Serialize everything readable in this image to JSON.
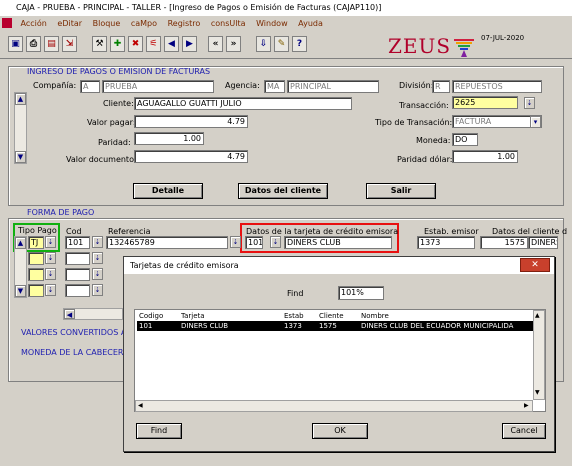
{
  "window": {
    "title": "CAJA - PRUEBA - PRINCIPAL - TALLER - [Ingreso de Pagos o Emisión de Facturas (CAJAP110)]"
  },
  "menu": [
    "Acción",
    "eDitar",
    "Bloque",
    "caMpo",
    "Registro",
    "consUlta",
    "Window",
    "Ayuda"
  ],
  "brand": {
    "name": "ZEUS",
    "date": "07-JUL-2020"
  },
  "header": {
    "section_title": "INGRESO DE PAGOS O EMISION DE FACTURAS",
    "compania_label": "Compañía:",
    "compania_code": "A",
    "compania_name": "PRUEBA",
    "agencia_label": "Agencia:",
    "agencia_code": "MA",
    "agencia_name": "PRINCIPAL",
    "division_label": "División:",
    "division_code": "R",
    "division_name": "REPUESTOS",
    "cliente_label": "Cliente:",
    "cliente_value": "AGUAGALLO GUATTI JULIO",
    "transaccion_label": "Transacción:",
    "transaccion_value": "2625",
    "valor_pagar_label": "Valor pagar:",
    "valor_pagar_value": "4.79",
    "tipo_transaccion_label": "Tipo de Transación:",
    "tipo_transaccion_value": "FACTURA",
    "paridad_label": "Paridad:",
    "paridad_value": "1.00",
    "moneda_label": "Moneda:",
    "moneda_value": "DO",
    "valor_documento_label": "Valor documento:",
    "valor_documento_value": "4.79",
    "paridad_dolar_label": "Paridad dólar:",
    "paridad_dolar_value": "1.00"
  },
  "actions": {
    "detalle": "Detalle",
    "datos_cliente": "Datos del cliente",
    "salir": "Salir"
  },
  "payment": {
    "section_title": "FORMA DE PAGO",
    "col_tipo_pago": "Tipo Pago",
    "col_cod": "Cod",
    "col_referencia": "Referencia",
    "col_datos_tarjeta": "Datos de la tarjeta de crédito emisora",
    "col_estab_emisor": "Estab. emisor",
    "col_datos_cliente": "Datos del cliente d",
    "row1": {
      "tipo": "TJ",
      "cod": "101",
      "referencia": "132465789",
      "tarjeta_code": "101",
      "tarjeta_name": "DINERS CLUB",
      "estab": "1373",
      "cliente_num": "1575",
      "cliente_name": "DINERS"
    },
    "valores_convertidos": "VALORES CONVERTIDOS A",
    "moneda_cabecera": "MONEDA DE LA CABECERA"
  },
  "dialog": {
    "title": "Tarjetas de crédito emisora",
    "find_label": "Find",
    "find_value": "101%",
    "columns": [
      "Codigo",
      "Tarjeta",
      "Estab",
      "Cliente",
      "Nombre"
    ],
    "rows": [
      [
        "101",
        "DINERS CLUB",
        "1373",
        "1575",
        "DINERS CLUB DEL ECUADOR MUNICIPALIDA"
      ]
    ],
    "btn_find": "Find",
    "btn_ok": "OK",
    "btn_cancel": "Cancel"
  },
  "colors": {
    "accent": "#2020b0",
    "brand": "#b0002a",
    "highlight_red": "#e81010",
    "highlight_green": "#10b010"
  }
}
